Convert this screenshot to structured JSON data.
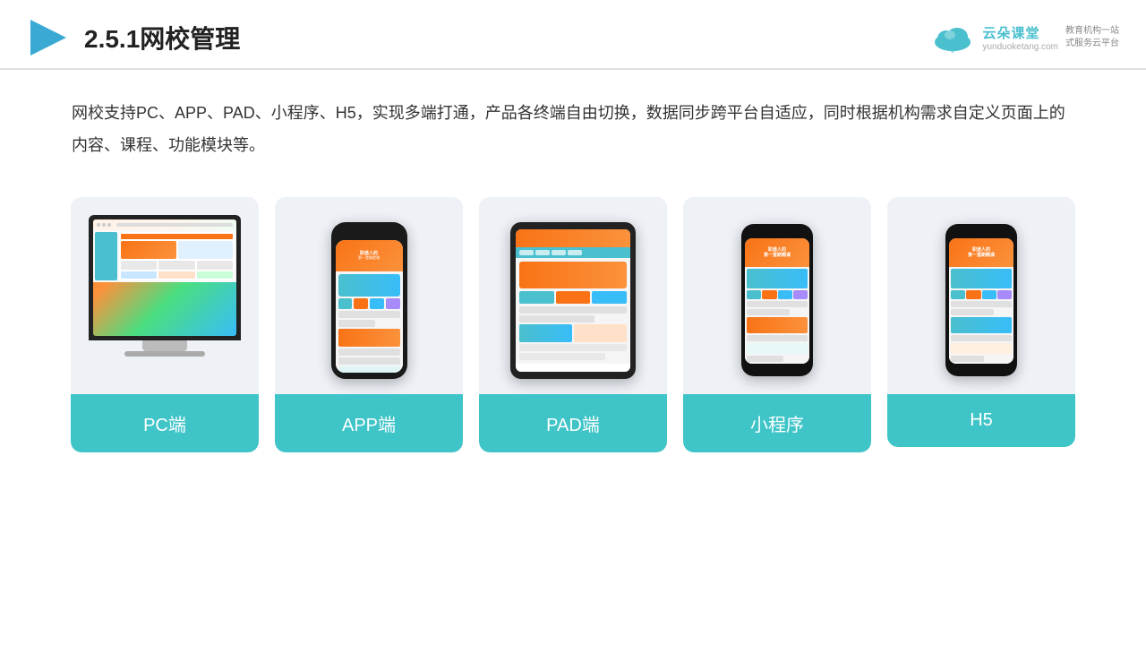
{
  "header": {
    "title": "2.5.1网校管理",
    "logo": {
      "name": "云朵课堂",
      "url": "yunduoketang.com",
      "tagline": "教育机构一站\n式服务云平台"
    }
  },
  "description": "网校支持PC、APP、PAD、小程序、H5，实现多端打通，产品各终端自由切换，数据同步跨平台自适应，同时根据机构需求自定义页面上的内容、课程、功能模块等。",
  "cards": [
    {
      "id": "pc",
      "label": "PC端"
    },
    {
      "id": "app",
      "label": "APP端"
    },
    {
      "id": "pad",
      "label": "PAD端"
    },
    {
      "id": "miniprogram",
      "label": "小程序"
    },
    {
      "id": "h5",
      "label": "H5"
    }
  ],
  "colors": {
    "accent": "#3FC4C8",
    "accent_light": "#4ABFCE",
    "orange": "#f97316",
    "text_main": "#333",
    "bg_card": "#eef2f7"
  }
}
